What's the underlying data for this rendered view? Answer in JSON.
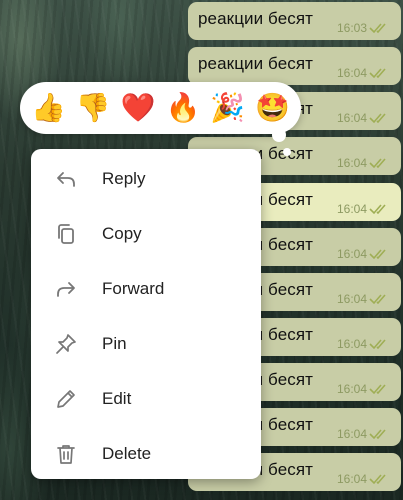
{
  "messages": [
    {
      "text": "реакции бесят",
      "time": "16:03",
      "highlight": false
    },
    {
      "text": "реакции бесят",
      "time": "16:04",
      "highlight": false
    },
    {
      "text": "реакции бесят",
      "time": "16:04",
      "highlight": false
    },
    {
      "text": "реакции бесят",
      "time": "16:04",
      "highlight": false
    },
    {
      "text": "реакции бесят",
      "time": "16:04",
      "highlight": true
    },
    {
      "text": "реакции бесят",
      "time": "16:04",
      "highlight": false
    },
    {
      "text": "реакции бесят",
      "time": "16:04",
      "highlight": false
    },
    {
      "text": "реакции бесят",
      "time": "16:04",
      "highlight": false
    },
    {
      "text": "реакции бесят",
      "time": "16:04",
      "highlight": false
    },
    {
      "text": "реакции бесят",
      "time": "16:04",
      "highlight": false
    },
    {
      "text": "реакции бесят",
      "time": "16:04",
      "highlight": false
    }
  ],
  "reactions": [
    {
      "emoji": "👍",
      "icon": "thumbs-up-icon"
    },
    {
      "emoji": "👎",
      "icon": "thumbs-down-icon"
    },
    {
      "emoji": "❤️",
      "icon": "heart-icon"
    },
    {
      "emoji": "🔥",
      "icon": "fire-icon"
    },
    {
      "emoji": "🎉",
      "icon": "party-popper-icon"
    },
    {
      "emoji": "🤩",
      "icon": "star-struck-icon"
    }
  ],
  "menu": {
    "items": [
      {
        "label": "Reply",
        "icon": "reply-icon"
      },
      {
        "label": "Copy",
        "icon": "copy-icon"
      },
      {
        "label": "Forward",
        "icon": "forward-icon"
      },
      {
        "label": "Pin",
        "icon": "pin-icon"
      },
      {
        "label": "Edit",
        "icon": "edit-icon"
      },
      {
        "label": "Delete",
        "icon": "delete-icon"
      }
    ]
  },
  "colors": {
    "bubble": "#c8cda6",
    "bubble_highlight": "#e9ecbe",
    "time_text": "#8d9a62",
    "tick": "#9fae55",
    "menu_icon": "#777777"
  }
}
